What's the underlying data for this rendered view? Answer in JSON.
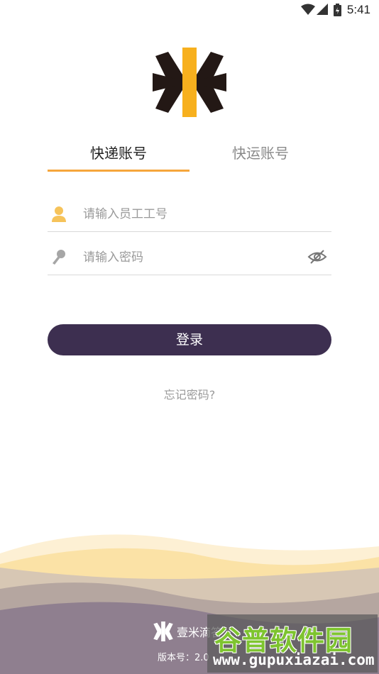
{
  "status_bar": {
    "time": "5:41"
  },
  "tabs": [
    {
      "label": "快递账号",
      "active": true
    },
    {
      "label": "快运账号",
      "active": false
    }
  ],
  "form": {
    "username_placeholder": "请输入员工工号",
    "password_placeholder": "请输入密码"
  },
  "login_label": "登录",
  "forgot_label": "忘记密码?",
  "footer": {
    "brand": "壹米滴答",
    "version_label": "版本号：2.0"
  },
  "watermark": {
    "title": "谷普软件园",
    "url": "www.gupuxiazai.com"
  },
  "colors": {
    "accent": "#f6a63c",
    "button": "#3d2f50",
    "logo_dark": "#231815",
    "logo_yellow": "#f7b01e"
  }
}
